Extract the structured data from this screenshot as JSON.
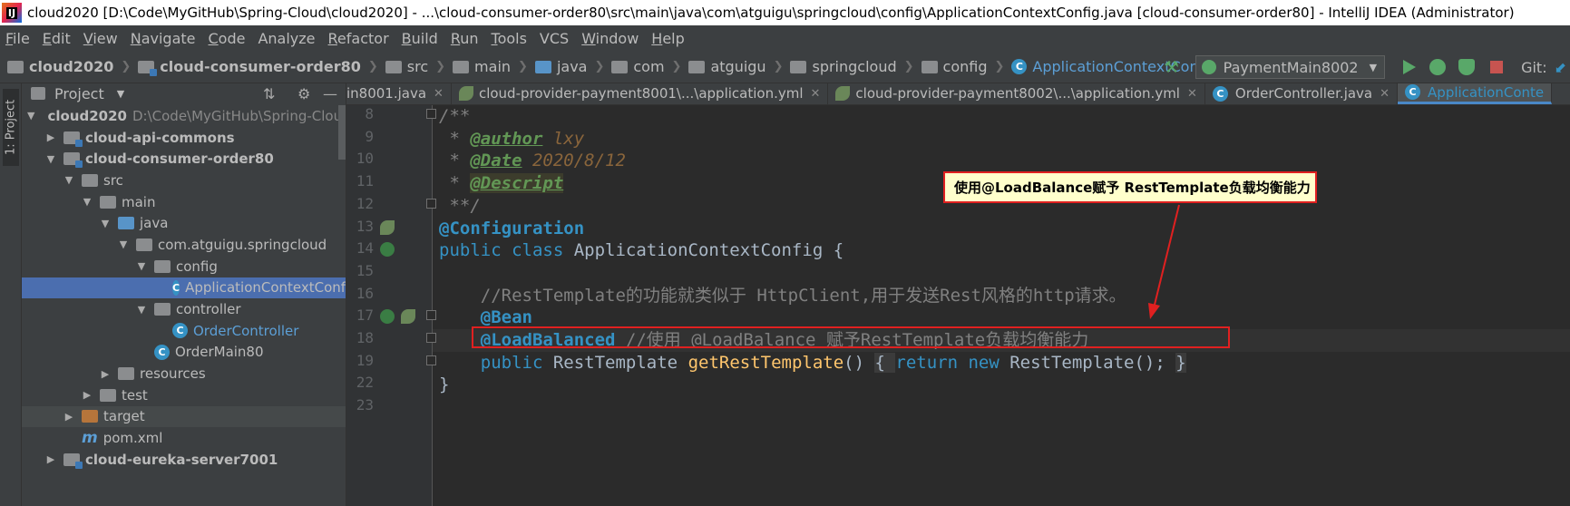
{
  "title_bar": {
    "app_icon": "intellij-icon",
    "text": "cloud2020 [D:\\Code\\MyGitHub\\Spring-Cloud\\cloud2020] - ...\\cloud-consumer-order80\\src\\main\\java\\com\\atguigu\\springcloud\\config\\ApplicationContextConfig.java [cloud-consumer-order80] - IntelliJ IDEA (Administrator)"
  },
  "menu": [
    {
      "first": "F",
      "rest": "ile"
    },
    {
      "first": "E",
      "rest": "dit"
    },
    {
      "first": "V",
      "rest": "iew"
    },
    {
      "first": "N",
      "rest": "avigate"
    },
    {
      "first": "C",
      "rest": "ode"
    },
    {
      "first": "",
      "rest": "Analyze"
    },
    {
      "first": "R",
      "rest": "efactor"
    },
    {
      "first": "B",
      "rest": "uild"
    },
    {
      "first": "R",
      "rest": "un"
    },
    {
      "first": "T",
      "rest": "ools"
    },
    {
      "first": "",
      "rest": "VCS"
    },
    {
      "first": "W",
      "rest": "indow"
    },
    {
      "first": "H",
      "rest": "elp"
    }
  ],
  "breadcrumbs": [
    "cloud2020",
    "cloud-consumer-order80",
    "src",
    "main",
    "java",
    "com",
    "atguigu",
    "springcloud",
    "config",
    "ApplicationContextConfig"
  ],
  "toolbar": {
    "run_config": "PaymentMain8002",
    "git_label": "Git:"
  },
  "tool_strip": {
    "project_label": "1: Project"
  },
  "project_panel": {
    "title": "Project",
    "tree": [
      {
        "label": "cloud2020",
        "path": "D:\\Code\\MyGitHub\\Spring-Cloud\\cl"
      },
      {
        "label": "cloud-api-commons"
      },
      {
        "label": "cloud-consumer-order80"
      },
      {
        "label": "src"
      },
      {
        "label": "main"
      },
      {
        "label": "java"
      },
      {
        "label": "com.atguigu.springcloud"
      },
      {
        "label": "config"
      },
      {
        "label": "ApplicationContextConfig"
      },
      {
        "label": "controller"
      },
      {
        "label": "OrderController"
      },
      {
        "label": "OrderMain80"
      },
      {
        "label": "resources"
      },
      {
        "label": "test"
      },
      {
        "label": "target"
      },
      {
        "label": "pom.xml"
      },
      {
        "label": "cloud-eureka-server7001"
      }
    ]
  },
  "tabs": [
    {
      "label": "in8001.java"
    },
    {
      "label": "cloud-provider-payment8001\\...\\application.yml"
    },
    {
      "label": "cloud-provider-payment8002\\...\\application.yml"
    },
    {
      "label": "OrderController.java"
    },
    {
      "label": "ApplicationConte"
    }
  ],
  "editor": {
    "line_numbers": [
      "8",
      "9",
      "10",
      "11",
      "12",
      "13",
      "14",
      "15",
      "16",
      "17",
      "18",
      "19",
      "22",
      "23"
    ],
    "code": {
      "l8": "/**",
      "l9_star": " * ",
      "l9_tag": "@author",
      "l9_val": " lxy",
      "l10_tag": "@Date",
      "l10_val": " 2020/8/12",
      "l11_tag": "@Descript",
      "l12": " **/",
      "l13": "@Configuration",
      "l14_kw1": "public ",
      "l14_kw2": "class ",
      "l14_rest": "ApplicationContextConfig {",
      "l16": "    //RestTemplate的功能就类似于 HttpClient,用于发送Rest风格的http请求。",
      "l17": "    @Bean",
      "l18_ann": "    @LoadBalanced",
      "l18_comment": " //使用 @LoadBalance 赋予RestTemplate负载均衡能力",
      "l19_kw": "    public ",
      "l19_type": "RestTemplate ",
      "l19_method": "getRestTemplate",
      "l19_paren": "() ",
      "l19_open": "{ ",
      "l19_ret": "return ",
      "l19_new": "new ",
      "l19_ctor": "RestTemplate(); ",
      "l19_close": "}",
      "l22": "}"
    }
  },
  "annotation": {
    "callout_text": "使用@LoadBalance赋予 RestTemplate负载均衡能力",
    "color": "#e02020"
  }
}
